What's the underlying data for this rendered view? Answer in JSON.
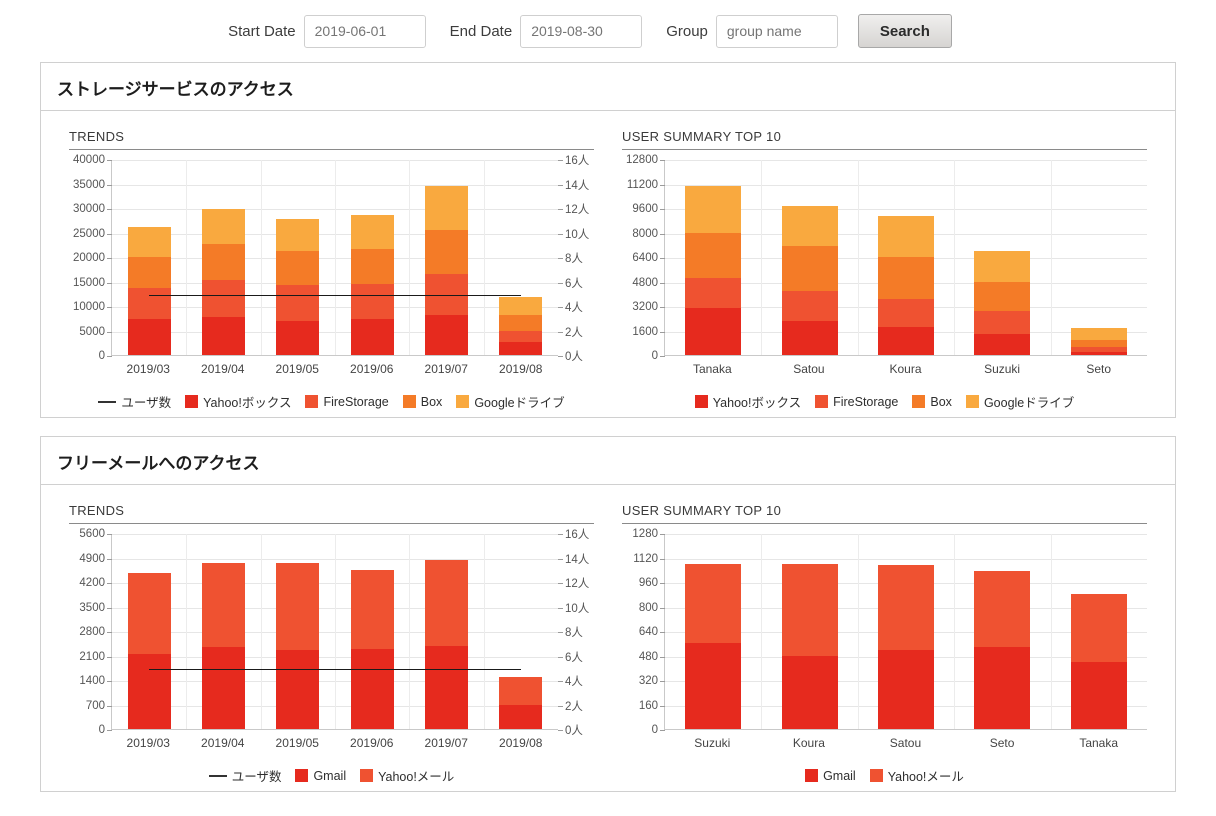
{
  "search": {
    "start_date_label": "Start Date",
    "start_date_value": "2019-06-01",
    "end_date_label": "End Date",
    "end_date_value": "2019-08-30",
    "group_label": "Group",
    "group_placeholder": "group name",
    "search_button": "Search"
  },
  "colors": {
    "series1": "#e62a1e",
    "series2": "#ef5231",
    "series3": "#f47b27",
    "series4": "#f9a93f",
    "avg_line": "#1a1a1a",
    "panel_border": "#d0d0d0",
    "grid": "#e6e6e6"
  },
  "panels": [
    {
      "title": "ストレージサービスのアクセス",
      "trends_title": "TRENDS",
      "summary_title": "USER SUMMARY TOP 10"
    },
    {
      "title": "フリーメールへのアクセス",
      "trends_title": "TRENDS",
      "summary_title": "USER SUMMARY TOP 10"
    }
  ],
  "chart_data": [
    {
      "id": "storage-trends",
      "type": "bar",
      "stacked": true,
      "title": "TRENDS",
      "xlabel": "",
      "ylabel": "",
      "categories": [
        "2019/03",
        "2019/04",
        "2019/05",
        "2019/06",
        "2019/07",
        "2019/08"
      ],
      "series": [
        {
          "name": "Yahoo!ボックス",
          "color": "#e62a1e",
          "values": [
            7400,
            7800,
            7000,
            7400,
            8100,
            2600
          ]
        },
        {
          "name": "FireStorage",
          "color": "#ef5231",
          "values": [
            6300,
            7500,
            7300,
            7000,
            8400,
            2300
          ]
        },
        {
          "name": "Box",
          "color": "#f47b27",
          "values": [
            6300,
            7400,
            7000,
            7300,
            9000,
            3300
          ]
        },
        {
          "name": "Googleドライブ",
          "color": "#f9a93f",
          "values": [
            6200,
            7000,
            6500,
            6900,
            9000,
            3600
          ]
        }
      ],
      "ylim": [
        0,
        40000
      ],
      "yticks": [
        0,
        5000,
        10000,
        15000,
        20000,
        25000,
        30000,
        35000,
        40000
      ],
      "y2lim": [
        0,
        16
      ],
      "y2ticks": [
        "0人",
        "2人",
        "4人",
        "6人",
        "8人",
        "10人",
        "12人",
        "14人",
        "16人"
      ],
      "average_line": {
        "name": "ユーザ数",
        "value": 5.0,
        "axis": "right"
      },
      "legend": [
        {
          "label": "ユーザ数",
          "type": "line",
          "color": "#333333"
        },
        {
          "label": "Yahoo!ボックス",
          "type": "box",
          "color": "#e62a1e"
        },
        {
          "label": "FireStorage",
          "type": "box",
          "color": "#ef5231"
        },
        {
          "label": "Box",
          "type": "box",
          "color": "#f47b27"
        },
        {
          "label": "Googleドライブ",
          "type": "box",
          "color": "#f9a93f"
        }
      ],
      "legend_position": "bottom",
      "grid": true
    },
    {
      "id": "storage-user-summary",
      "type": "bar",
      "stacked": true,
      "title": "USER SUMMARY TOP 10",
      "xlabel": "",
      "ylabel": "",
      "categories": [
        "Tanaka",
        "Satou",
        "Koura",
        "Suzuki",
        "Seto"
      ],
      "series": [
        {
          "name": "Yahoo!ボックス",
          "color": "#e62a1e",
          "values": [
            3050,
            2250,
            1850,
            1400,
            200
          ]
        },
        {
          "name": "FireStorage",
          "color": "#ef5231",
          "values": [
            2000,
            1950,
            1800,
            1500,
            300
          ]
        },
        {
          "name": "Box",
          "color": "#f47b27",
          "values": [
            2950,
            2950,
            2750,
            1850,
            500
          ]
        },
        {
          "name": "Googleドライブ",
          "color": "#f9a93f",
          "values": [
            3050,
            2600,
            2700,
            2050,
            750
          ]
        }
      ],
      "ylim": [
        0,
        12800
      ],
      "yticks": [
        0,
        1600,
        3200,
        4800,
        6400,
        8000,
        9600,
        11200,
        12800
      ],
      "legend": [
        {
          "label": "Yahoo!ボックス",
          "type": "box",
          "color": "#e62a1e"
        },
        {
          "label": "FireStorage",
          "type": "box",
          "color": "#ef5231"
        },
        {
          "label": "Box",
          "type": "box",
          "color": "#f47b27"
        },
        {
          "label": "Googleドライブ",
          "type": "box",
          "color": "#f9a93f"
        }
      ],
      "legend_position": "bottom",
      "grid": true
    },
    {
      "id": "freemail-trends",
      "type": "bar",
      "stacked": true,
      "title": "TRENDS",
      "xlabel": "",
      "ylabel": "",
      "categories": [
        "2019/03",
        "2019/04",
        "2019/05",
        "2019/06",
        "2019/07",
        "2019/08"
      ],
      "series": [
        {
          "name": "Gmail",
          "color": "#e62a1e",
          "values": [
            2130,
            2330,
            2250,
            2300,
            2370,
            700
          ]
        },
        {
          "name": "Yahoo!メール",
          "color": "#ef5231",
          "values": [
            2320,
            2420,
            2480,
            2230,
            2470,
            800
          ]
        }
      ],
      "ylim": [
        0,
        5600
      ],
      "yticks": [
        0,
        700,
        1400,
        2100,
        2800,
        3500,
        4200,
        4900,
        5600
      ],
      "y2lim": [
        0,
        16
      ],
      "y2ticks": [
        "0人",
        "2人",
        "4人",
        "6人",
        "8人",
        "10人",
        "12人",
        "14人",
        "16人"
      ],
      "average_line": {
        "name": "ユーザ数",
        "value": 5.0,
        "axis": "right"
      },
      "legend": [
        {
          "label": "ユーザ数",
          "type": "line",
          "color": "#333333"
        },
        {
          "label": "Gmail",
          "type": "box",
          "color": "#e62a1e"
        },
        {
          "label": "Yahoo!メール",
          "type": "box",
          "color": "#ef5231"
        }
      ],
      "legend_position": "bottom",
      "grid": true
    },
    {
      "id": "freemail-user-summary",
      "type": "bar",
      "stacked": true,
      "title": "USER SUMMARY TOP 10",
      "xlabel": "",
      "ylabel": "",
      "categories": [
        "Suzuki",
        "Koura",
        "Satou",
        "Seto",
        "Tanaka"
      ],
      "series": [
        {
          "name": "Gmail",
          "color": "#e62a1e",
          "values": [
            560,
            475,
            515,
            535,
            435
          ]
        },
        {
          "name": "Yahoo!メール",
          "color": "#ef5231",
          "values": [
            520,
            605,
            555,
            495,
            445
          ]
        }
      ],
      "ylim": [
        0,
        1280
      ],
      "yticks": [
        0,
        160,
        320,
        480,
        640,
        800,
        960,
        1120,
        1280
      ],
      "legend": [
        {
          "label": "Gmail",
          "type": "box",
          "color": "#e62a1e"
        },
        {
          "label": "Yahoo!メール",
          "type": "box",
          "color": "#ef5231"
        }
      ],
      "legend_position": "bottom",
      "grid": true
    }
  ]
}
